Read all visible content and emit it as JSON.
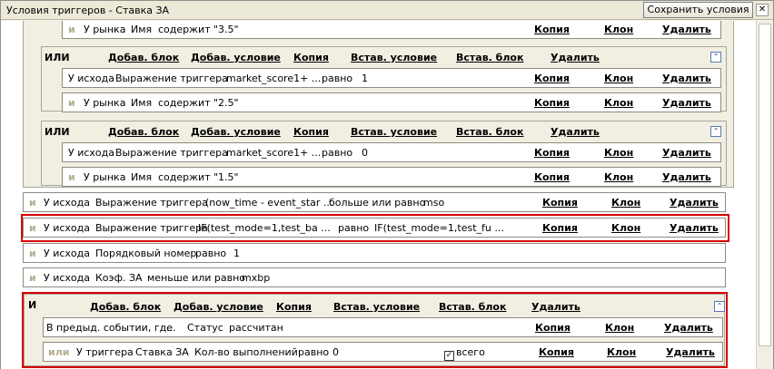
{
  "window": {
    "title": "Условия триггеров - Ставка ЗА",
    "save_label": "Сохранить условия",
    "close_glyph": "✕"
  },
  "actions": {
    "copy": "Копия",
    "clone": "Клон",
    "delete": "Удалить",
    "add_block": "Добав. блок",
    "add_condition": "Добав. условие",
    "insert_condition": "Встав. условие",
    "insert_block": "Встав. блок"
  },
  "conj": {
    "and": "и",
    "or_upper": "ИЛИ",
    "or_lower": "или",
    "and_upper": "И"
  },
  "rows": {
    "r1": {
      "source": "У рынка",
      "field": "Имя",
      "op": "содержит",
      "value": "\"3.5\""
    },
    "r2": {
      "source": "У исхода",
      "field": "Выражение триггера",
      "expr": "market_score1+ ...",
      "op": "равно",
      "value": "1"
    },
    "r3": {
      "source": "У рынка",
      "field": "Имя",
      "op": "содержит",
      "value": "\"2.5\""
    },
    "r4": {
      "source": "У исхода",
      "field": "Выражение триггера",
      "expr": "market_score1+ ...",
      "op": "равно",
      "value": "0"
    },
    "r5": {
      "source": "У рынка",
      "field": "Имя",
      "op": "содержит",
      "value": "\"1.5\""
    },
    "r6": {
      "source": "У исхода",
      "field": "Выражение триггера",
      "expr": "(now_time - event_star ...",
      "op": "больше или равно",
      "value": "mso"
    },
    "r7": {
      "source": "У исхода",
      "field": "Выражение триггера",
      "expr": "IF(test_mode=1,test_ba ...",
      "op": "равно",
      "value": "IF(test_mode=1,test_fu ..."
    },
    "r8": {
      "source": "У исхода",
      "field": "Порядковый номер",
      "op": "равно",
      "value": "1"
    },
    "r9": {
      "source": "У исхода",
      "field": "Коэф. ЗА",
      "op": "меньше или равно",
      "value": "mxbp"
    },
    "r10": {
      "source": "В предыд. событии, где",
      "field": "...",
      "op": "Статус",
      "value": "рассчитан"
    },
    "r11": {
      "source": "У триггера",
      "field": "Ставка ЗА",
      "expr": "Кол-во выполнений",
      "op": "равно",
      "value": "0",
      "checkbox_label": "всего"
    }
  }
}
